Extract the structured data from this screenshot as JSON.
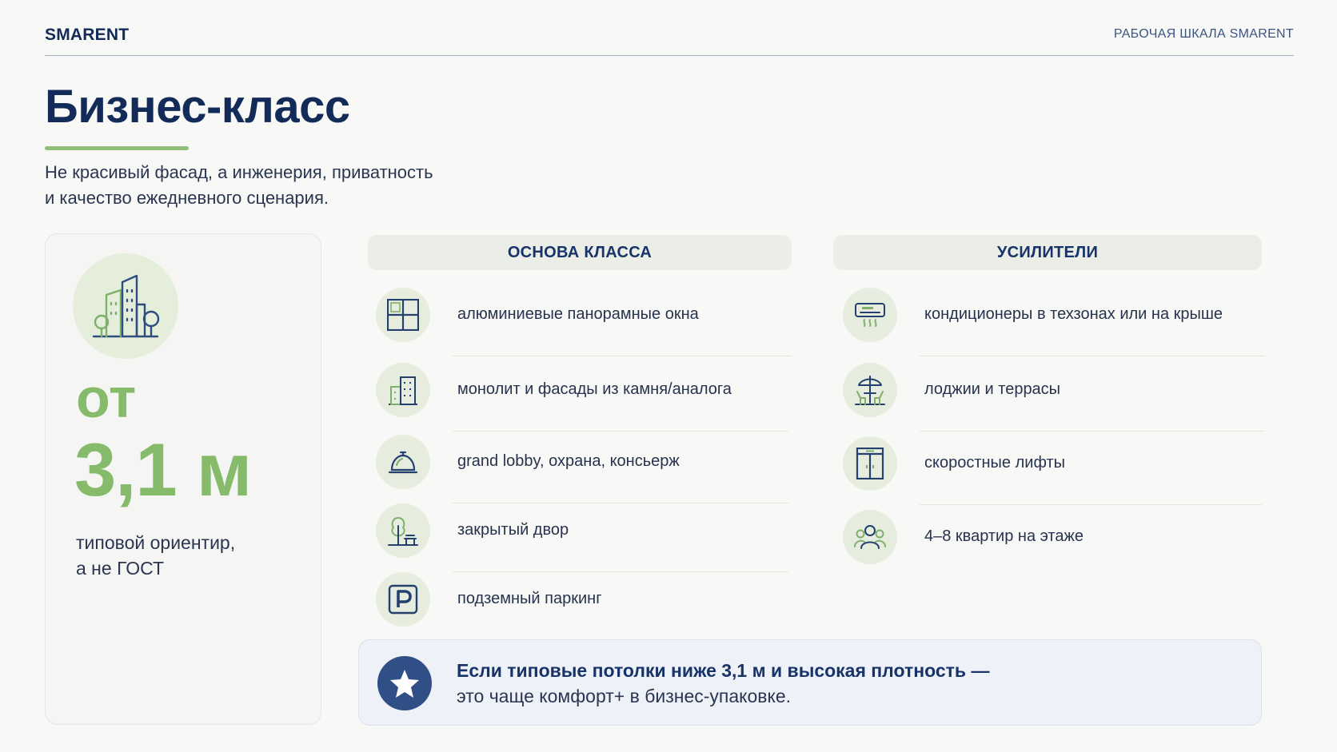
{
  "header": {
    "brand": "SMARENT",
    "tag": "РАБОЧАЯ ШКАЛА SMARENT"
  },
  "title": "Бизнес-класс",
  "subtitle": {
    "line1": "Не красивый фасад, а инженерия, приватность",
    "line2": "и качество ежедневного сценария."
  },
  "summary": {
    "icon": "building-trees-icon",
    "prefix": "от",
    "value": "3,1 м",
    "note_line1": "типовой ориентир,",
    "note_line2": "а не ГОСТ"
  },
  "basis": {
    "heading": "ОСНОВА КЛАССА",
    "items": [
      {
        "icon": "window-icon",
        "label": "алюминиевые панорамные окна"
      },
      {
        "icon": "building-icon",
        "label": "монолит и фасады из камня/аналога"
      },
      {
        "icon": "concierge-bell-icon",
        "label": "grand lobby, охрана, консьерж"
      },
      {
        "icon": "tree-bench-icon",
        "label": "закрытый двор"
      },
      {
        "icon": "parking-icon",
        "label": "подземный паркинг"
      }
    ]
  },
  "boosters": {
    "heading": "УСИЛИТЕЛИ",
    "items": [
      {
        "icon": "air-conditioner-icon",
        "label": "кондиционеры в техзонах или на крыше"
      },
      {
        "icon": "terrace-umbrella-icon",
        "label": "лоджии и террасы"
      },
      {
        "icon": "elevator-icon",
        "label": "скоростные лифты"
      },
      {
        "icon": "people-group-icon",
        "label": "4–8 квартир на этаже"
      }
    ]
  },
  "callout": {
    "icon": "star-icon",
    "line1": "Если типовые потолки ниже 3,1 м и высокая плотность —",
    "line2": "это чаще комфорт+ в бизнес-упаковке."
  },
  "colors": {
    "navy": "#132b58",
    "accent_green": "#86bb6c",
    "icon_bg": "#e6eddf",
    "callout_bg": "#eef2f8",
    "star_bg": "#2f4f86"
  }
}
